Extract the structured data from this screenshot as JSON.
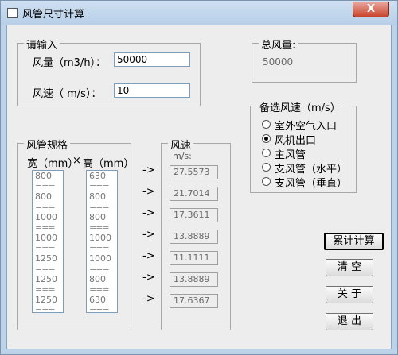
{
  "window": {
    "title": "风管尺寸计算",
    "close_glyph": "X"
  },
  "input_group": {
    "label": "请输入",
    "flow_label": "风量（m3/h）：",
    "flow_value": "50000",
    "speed_label": "风速（ m/s）：",
    "speed_value": "10"
  },
  "total_group": {
    "label": "总风量:",
    "value": "50000"
  },
  "speed_options": {
    "label": "备选风速（m/s）",
    "selected_index": 1,
    "items": [
      "室外空气入口",
      "风机出口",
      "主风管",
      "支风管（水平）",
      "支风管（垂直）"
    ]
  },
  "size_group": {
    "label": "风管规格",
    "width_header": "宽（mm）",
    "times": "×",
    "height_header": "高（mm）",
    "separator": "===",
    "widths": [
      "800",
      "800",
      "1000",
      "1000",
      "1250",
      "1250",
      "1250"
    ],
    "heights": [
      "630",
      "800",
      "800",
      "1000",
      "1000",
      "800",
      "630"
    ]
  },
  "speed_group": {
    "label": "风速",
    "unit": "m/s:",
    "arrow": "->",
    "values": [
      "27.5573",
      "21.7014",
      "17.3611",
      "13.8889",
      "11.1111",
      "13.8889",
      "17.6367"
    ]
  },
  "buttons": {
    "calculate": "累计计算",
    "clear": "清  空",
    "about": "关  于",
    "exit": "退  出"
  }
}
